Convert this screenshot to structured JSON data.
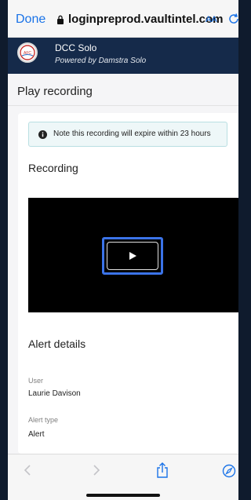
{
  "safari": {
    "done_label": "Done",
    "url": "loginpreprod.vaultintel.com",
    "text_size_label": "AA"
  },
  "app": {
    "logo_text": "AFC",
    "name": "DCC Solo",
    "subtitle": "Powered by Damstra Solo"
  },
  "page": {
    "title": "Play recording"
  },
  "notice": {
    "text": "Note this recording will expire within 23 hours"
  },
  "recording": {
    "section_title": "Recording"
  },
  "alert_details": {
    "section_title": "Alert details",
    "fields": [
      {
        "label": "User",
        "value": "Laurie Davison"
      },
      {
        "label": "Alert type",
        "value": "Alert"
      }
    ]
  },
  "colors": {
    "accent": "#1a73e8",
    "header_bg": "#152a4a",
    "focus_ring": "#3b73e8"
  }
}
